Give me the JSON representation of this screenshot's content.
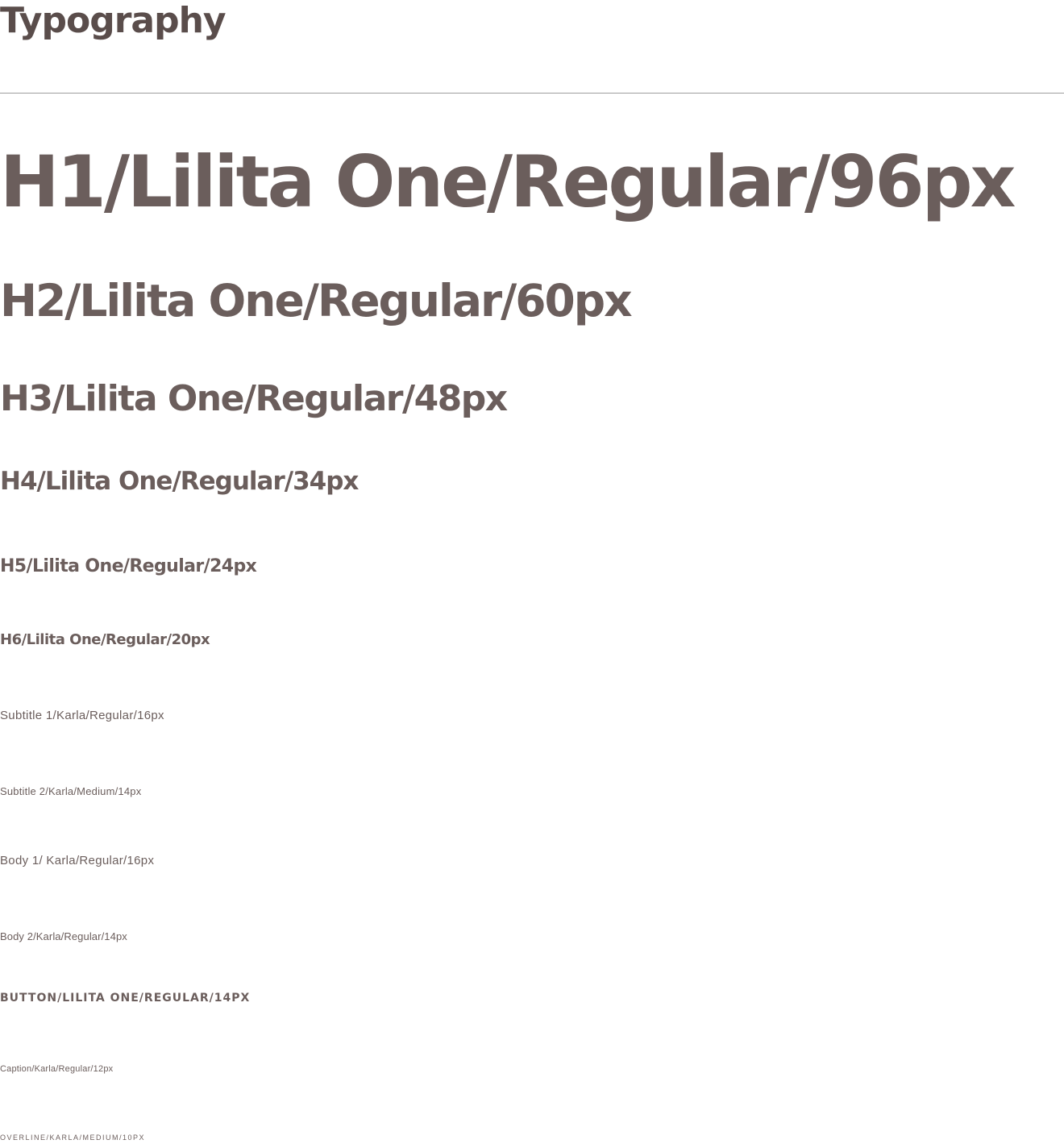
{
  "page": {
    "title": "Typography"
  },
  "styles": [
    {
      "key": "h1",
      "label": "H1/Lilita One/Regular/96px"
    },
    {
      "key": "h2",
      "label": "H2/Lilita One/Regular/60px"
    },
    {
      "key": "h3",
      "label": "H3/Lilita One/Regular/48px"
    },
    {
      "key": "h4",
      "label": "H4/Lilita One/Regular/34px"
    },
    {
      "key": "h5",
      "label": "H5/Lilita One/Regular/24px"
    },
    {
      "key": "h6",
      "label": "H6/Lilita One/Regular/20px"
    },
    {
      "key": "subtitle1",
      "label": "Subtitle 1/Karla/Regular/16px"
    },
    {
      "key": "subtitle2",
      "label": "Subtitle 2/Karla/Medium/14px"
    },
    {
      "key": "body1",
      "label": "Body 1/ Karla/Regular/16px"
    },
    {
      "key": "body2",
      "label": "Body 2/Karla/Regular/14px"
    },
    {
      "key": "button",
      "label": "BUTTON/LILITA ONE/REGULAR/14PX"
    },
    {
      "key": "caption",
      "label": "Caption/Karla/Regular/12px"
    },
    {
      "key": "overline",
      "label": "OVERLINE/KARLA/MEDIUM/10PX"
    }
  ],
  "colors": {
    "text": "#6b5e5c",
    "title": "#5a4d4b",
    "divider": "#9e9e9e"
  }
}
